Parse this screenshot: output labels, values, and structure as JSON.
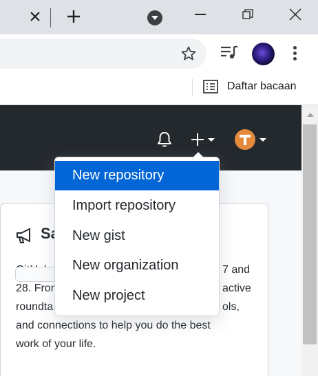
{
  "browser": {
    "tab_close_icon": "close-icon",
    "new_tab_icon": "plus-icon",
    "tab_search_icon": "chevron-down-icon",
    "bookmark_star_icon": "star-icon",
    "media_icon": "playlist-icon",
    "menu_icon": "kebab-menu-icon",
    "reading_list": {
      "label": "Daftar bacaan",
      "icon": "reading-list-icon"
    }
  },
  "github": {
    "header": {
      "notifications_icon": "bell-icon",
      "create_icon": "plus-icon",
      "avatar_icon": "user-avatar",
      "background": "#24292e"
    },
    "create_menu": {
      "items": [
        {
          "label": "New repository",
          "active": true
        },
        {
          "label": "Import repository"
        },
        {
          "label": "New gist"
        },
        {
          "label": "New organization"
        },
        {
          "label": "New project"
        }
      ]
    },
    "announcement": {
      "title_visible": "Sa",
      "icon": "megaphone-icon",
      "close_icon": "close-icon",
      "lines": [
        [
          "GitHub",
          "7 and"
        ],
        [
          "28. Fron",
          "active"
        ],
        [
          "roundta",
          "ols,"
        ],
        [
          "and connections to help you do the best",
          ""
        ],
        [
          "work of your life.",
          ""
        ]
      ]
    },
    "accent_color": "#0366d6"
  }
}
